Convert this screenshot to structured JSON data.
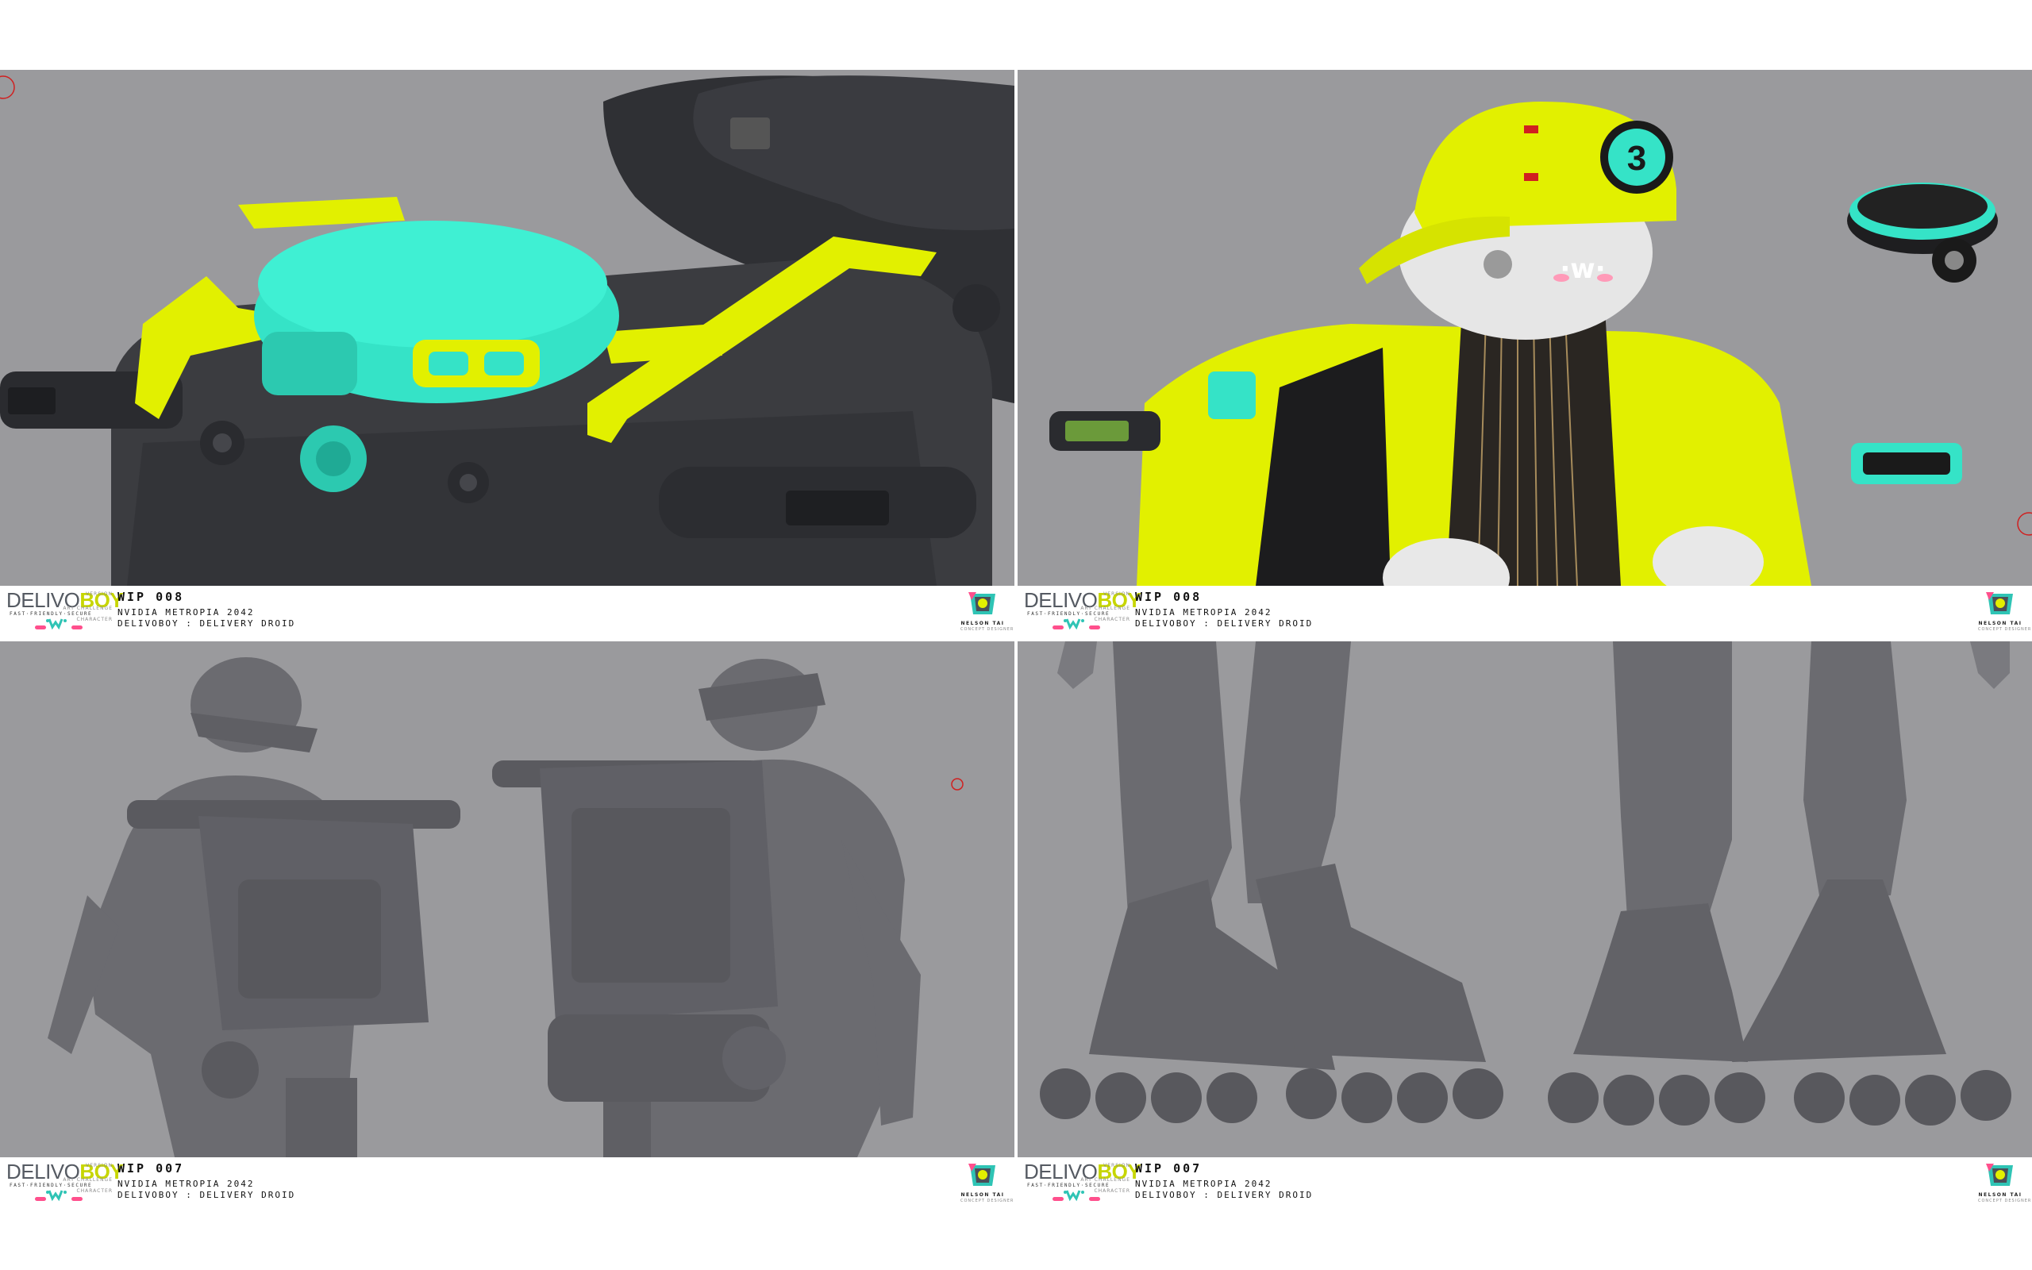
{
  "panels": [
    {
      "version": "WIP 008",
      "challenge": "NVIDIA METROPIA 2042",
      "character": "DELIVOBOY : DELIVERY DROID",
      "view": "backpack-drone-closeup"
    },
    {
      "version": "WIP 008",
      "challenge": "NVIDIA METROPIA 2042",
      "character": "DELIVOBOY : DELIVERY DROID",
      "view": "head-cap-color"
    },
    {
      "version": "WIP 007",
      "challenge": "NVIDIA METROPIA 2042",
      "character": "DELIVOBOY : DELIVERY DROID",
      "view": "backpack-rear-sculpt"
    },
    {
      "version": "WIP 007",
      "challenge": "NVIDIA METROPIA 2042",
      "character": "DELIVOBOY : DELIVERY DROID",
      "view": "rollerblade-legs-sculpt"
    }
  ],
  "labels": {
    "version": "VERSION",
    "challenge": "ART CHALLENGE",
    "character": "CHARACTER"
  },
  "logo": {
    "word_part1": "DELIVO",
    "word_part2": "BOY",
    "tagline": "FAST·FRIENDLY·SECURE"
  },
  "badge": {
    "name": "NELSON TAI",
    "role": "CONCEPT DESIGNER"
  },
  "cap_number": "3",
  "face_text": "·w·",
  "colors": {
    "viewport": "#9a9a9d",
    "sculpt": "#6b6b70",
    "hard": "#3e3f43",
    "lime": "#e2f000",
    "cyan": "#35e3c7",
    "logo_lime": "#c7d600",
    "pink": "#ff4f8c",
    "teal": "#2fc4b5"
  }
}
